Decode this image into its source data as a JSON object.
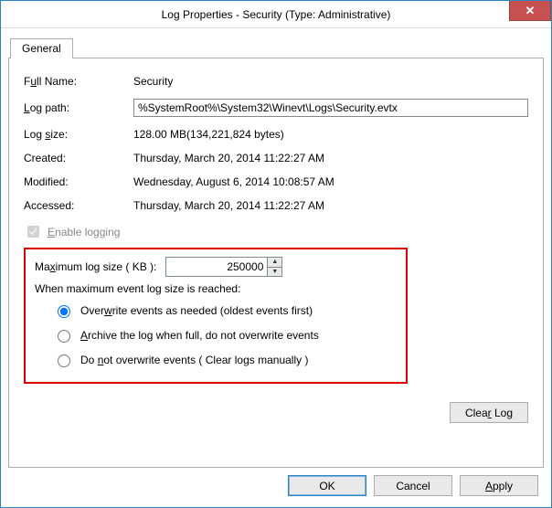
{
  "window": {
    "title": "Log Properties - Security (Type: Administrative)"
  },
  "tabs": {
    "general": "General"
  },
  "fields": {
    "fullname_label_pre": "F",
    "fullname_label_u": "u",
    "fullname_label_post": "ll Name:",
    "fullname_value": "Security",
    "logpath_label_pre": "",
    "logpath_label_u": "L",
    "logpath_label_post": "og path:",
    "logpath_value": "%SystemRoot%\\System32\\Winevt\\Logs\\Security.evtx",
    "logsize_label_pre": "Log ",
    "logsize_label_u": "s",
    "logsize_label_post": "ize:",
    "logsize_value": "128.00 MB(134,221,824 bytes)",
    "created_label": "Created:",
    "created_value": "Thursday, March 20, 2014 11:22:27 AM",
    "modified_label": "Modified:",
    "modified_value": "Wednesday, August 6, 2014 10:08:57 AM",
    "accessed_label": "Accessed:",
    "accessed_value": "Thursday, March 20, 2014 11:22:27 AM"
  },
  "enable": {
    "label_pre": "",
    "label_u": "E",
    "label_post": "nable logging"
  },
  "maxsize": {
    "label_pre": "Ma",
    "label_u": "x",
    "label_post": "imum log size ( KB ):",
    "value": "250000"
  },
  "when_label": "When maximum event log size is reached:",
  "radios": {
    "overwrite_pre": "Over",
    "overwrite_u": "w",
    "overwrite_post": "rite events as needed (oldest events first)",
    "archive_pre": "",
    "archive_u": "A",
    "archive_post": "rchive the log when full, do not overwrite events",
    "donot_pre": "Do ",
    "donot_u": "n",
    "donot_post": "ot overwrite events ( Clear logs manually )"
  },
  "buttons": {
    "clear_pre": "Clea",
    "clear_u": "r",
    "clear_post": " Log",
    "ok": "OK",
    "cancel": "Cancel",
    "apply_pre": "",
    "apply_u": "A",
    "apply_post": "pply"
  }
}
